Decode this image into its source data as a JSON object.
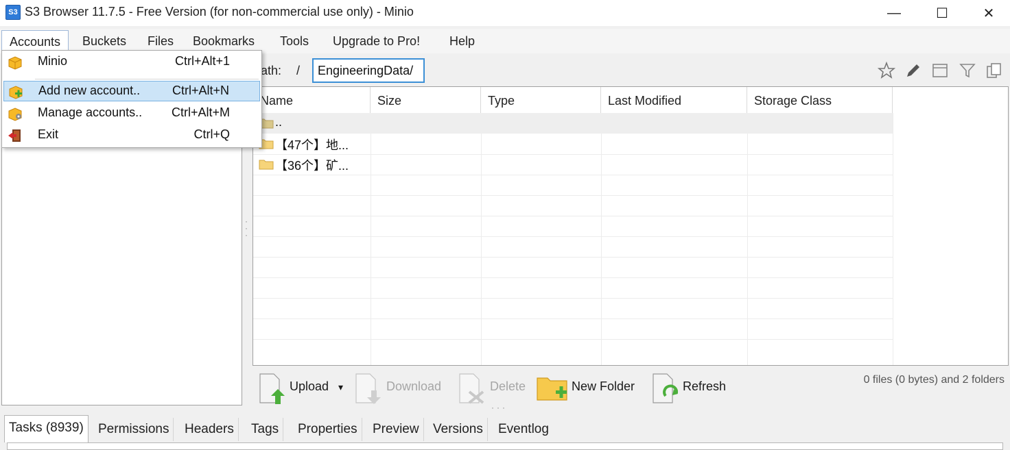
{
  "window": {
    "title": "S3 Browser 11.7.5 - Free Version (for non-commercial use only) - Minio",
    "icon_text": "S3",
    "minimize": "—",
    "maximize": "☐",
    "close": "✕"
  },
  "menu": {
    "items": [
      "Accounts",
      "Buckets",
      "Files",
      "Bookmarks",
      "Tools",
      "Upgrade to Pro!",
      "Help"
    ],
    "active": "Accounts"
  },
  "accounts_dropdown": {
    "items": [
      {
        "label": "Minio",
        "shortcut": "Ctrl+Alt+1",
        "icon": "account-box-icon"
      },
      {
        "label": "Add new account..",
        "shortcut": "Ctrl+Alt+N",
        "icon": "add-account-icon"
      },
      {
        "label": "Manage accounts..",
        "shortcut": "Ctrl+Alt+M",
        "icon": "manage-accounts-icon"
      },
      {
        "label": "Exit",
        "shortcut": "Ctrl+Q",
        "icon": "exit-icon"
      }
    ],
    "highlighted": "Add new account.."
  },
  "path": {
    "label": "ath:",
    "separator": "/",
    "value": "EngineeringData/"
  },
  "file_list": {
    "columns": [
      "Name",
      "Size",
      "Type",
      "Last Modified",
      "Storage Class"
    ],
    "rows": [
      {
        "name": "..",
        "type": "parent"
      },
      {
        "name": "【47个】地...",
        "type": "folder"
      },
      {
        "name": "【36个】矿...",
        "type": "folder"
      }
    ]
  },
  "actions": {
    "upload": "Upload",
    "upload_caret": "▾",
    "download": "Download",
    "delete": "Delete",
    "new_folder": "New Folder",
    "refresh": "Refresh"
  },
  "status": "0 files (0 bytes) and 2 folders",
  "tabs": {
    "items": [
      "Tasks (8939)",
      "Permissions",
      "Headers",
      "Tags",
      "Properties",
      "Preview",
      "Versions",
      "Eventlog"
    ],
    "active": "Tasks (8939)"
  },
  "colors": {
    "accent": "#3b8fd6",
    "highlight": "#cce4f7",
    "folder": "#f3c560"
  }
}
